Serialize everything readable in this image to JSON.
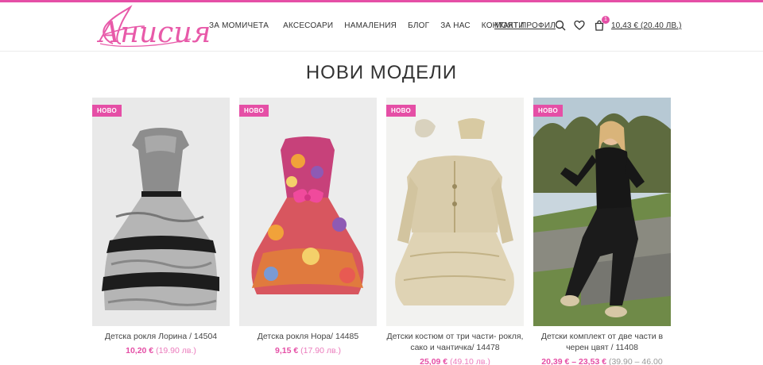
{
  "brand": {
    "logo_text": "Анисия",
    "accent": "#e54fa6"
  },
  "nav": {
    "items": [
      {
        "label": "ЗА МОМИЧЕТА"
      },
      {
        "label": "АКСЕСОАРИ"
      },
      {
        "label": "НАМАЛЕНИЯ"
      },
      {
        "label": "БЛОГ"
      },
      {
        "label": "ЗА НАС"
      },
      {
        "label": "КОНТАКТИ"
      }
    ],
    "profile": "МОЯТ ПРОФИЛ",
    "cart_count": "1",
    "cart_total": "10,43 € (20.40 ЛВ.)"
  },
  "section": {
    "title": "НОВИ МОДЕЛИ"
  },
  "products": [
    {
      "badge": "НОВО",
      "name": "Детска рокля Лорина / 14504",
      "price_eur": "10,20 €",
      "price_bgn": "(19.90 лв.)",
      "image": "dress-grey-black"
    },
    {
      "badge": "НОВО",
      "name": "Детска рокля Нора/ 14485",
      "price_eur": "9,15 €",
      "price_bgn": "(17.90 лв.)",
      "image": "dress-floral"
    },
    {
      "badge": "НОВО",
      "name": "Детски костюм от три части- рокля, сако и чантичка/ 14478",
      "price_eur": "25,09 €",
      "price_bgn": "(49.10 лв.)",
      "image": "suit-beige"
    },
    {
      "badge": "НОВО",
      "name": "Детски комплект от две части в черен цвят / 11408",
      "price_eur": "20,39 € – 23,53 €",
      "price_bgn": "(39.90 – 46.00",
      "image": "model-black-set"
    }
  ]
}
